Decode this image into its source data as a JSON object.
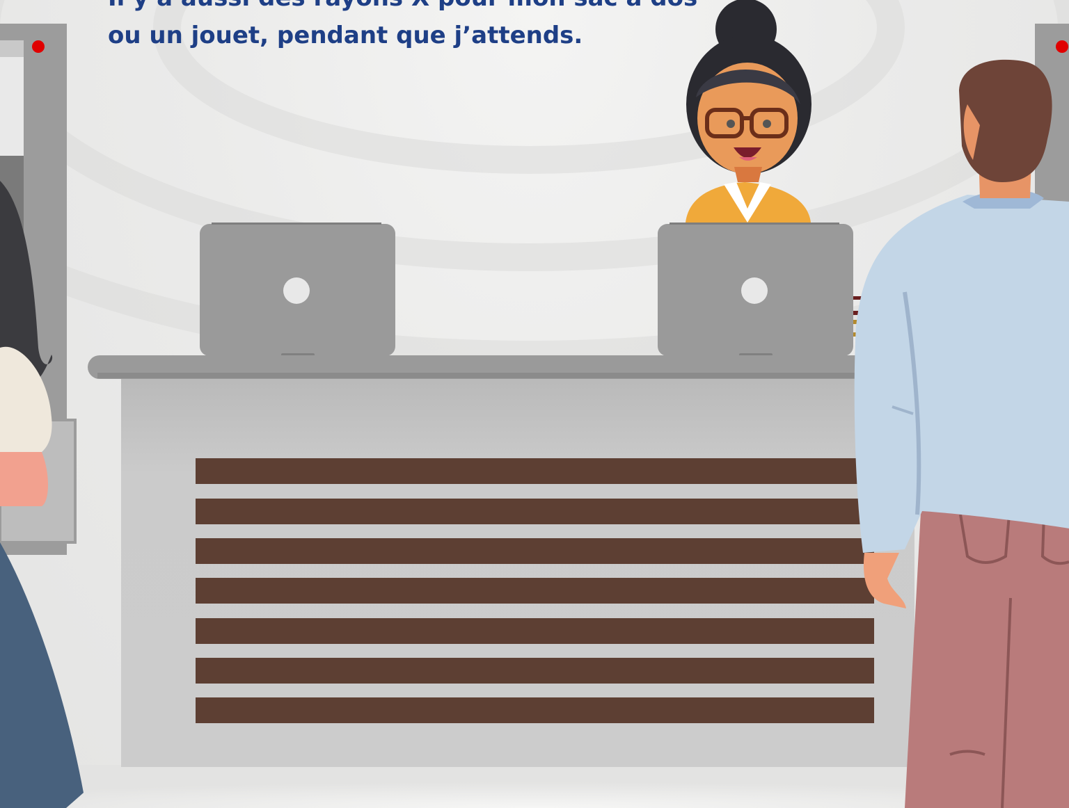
{
  "caption": {
    "line1": "Il y a aussi des rayons X pour mon sac à dos",
    "line2": "ou un jouet, pendant que j’attends."
  },
  "colors": {
    "caption_text": "#1e3f86",
    "desk_top": "#9a9a9a",
    "desk_front": "#cccccc",
    "desk_slats": "#5d3f33",
    "laptop": "#9a9a9a",
    "agent_jacket": "#f0a93a",
    "traveller_shirt": "#c3d6e7",
    "traveller_trousers": "#b97b7b",
    "scanner_light": "#e00000"
  },
  "icons": [
    "laptop-icon",
    "laptop-icon"
  ]
}
